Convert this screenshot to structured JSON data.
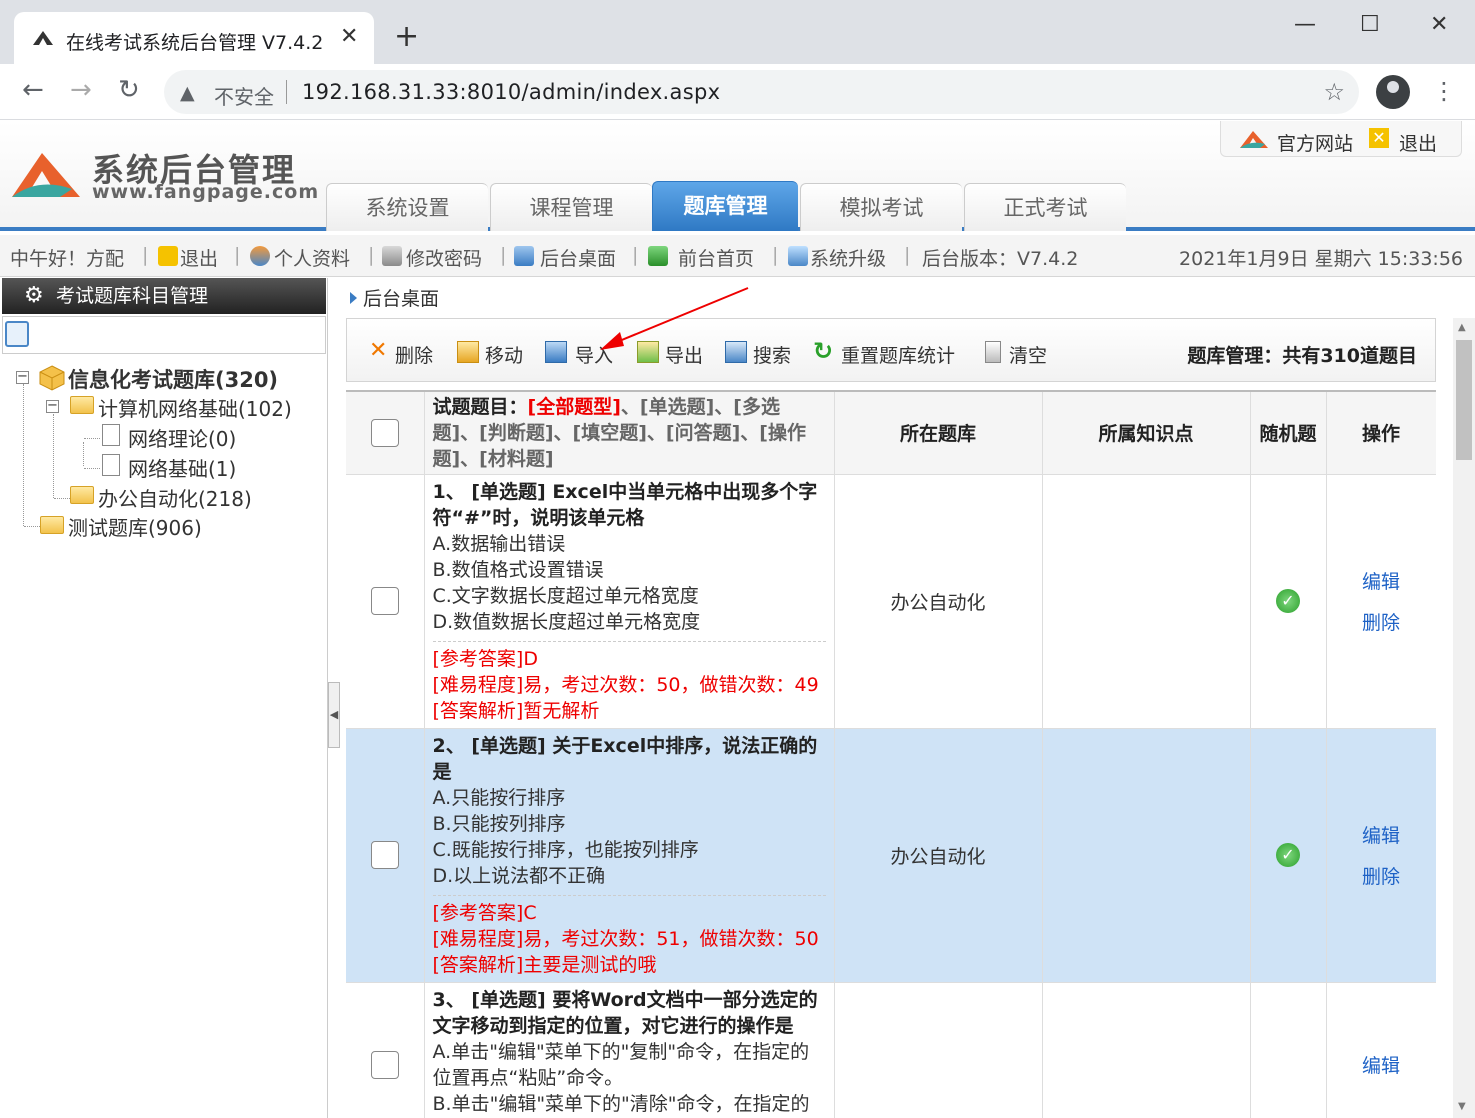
{
  "browser": {
    "tab_title": "在线考试系统后台管理 V7.4.2",
    "tab_close": "✕",
    "new_tab": "+",
    "insecure_label": "不安全",
    "url": "192.168.31.33:8010/admin/index.aspx"
  },
  "header": {
    "logo_title": "系统后台管理",
    "logo_url": "www.fangpage.com",
    "official_site": "官方网站",
    "logout": "退出",
    "nav": [
      "系统设置",
      "课程管理",
      "题库管理",
      "模拟考试",
      "正式考试"
    ],
    "active_nav": "题库管理"
  },
  "infobar": {
    "greeting": "中午好！方配",
    "logout": "退出",
    "profile": "个人资料",
    "password": "修改密码",
    "desktop": "后台桌面",
    "home": "前台首页",
    "upgrade": "系统升级",
    "version": "后台版本：V7.4.2",
    "datetime": "2021年1月9日  星期六 15:33:56"
  },
  "leftpanel": {
    "title": "考试题库科目管理",
    "search_placeholder": "",
    "tree": {
      "root": "信息化考试题库(320)",
      "child1": "计算机网络基础(102)",
      "child1a": "网络理论(0)",
      "child1b": "网络基础(1)",
      "child2": "办公自动化(218)",
      "root2": "测试题库(906)"
    }
  },
  "content": {
    "breadcrumb": "后台桌面",
    "actions": {
      "delete": "删除",
      "move": "移动",
      "import": "导入",
      "export": "导出",
      "search": "搜索",
      "reset": "重置题库统计",
      "clear": "清空"
    },
    "summary": "题库管理：共有310道题目",
    "table": {
      "header_prefix": "试题题目：",
      "header_all": "[全部题型]",
      "header_types": "、[单选题]、[多选题]、[判断题]、[填空题]、[问答题]、[操作题]、[材料题]",
      "col_bank": "所在题库",
      "col_knowledge": "所属知识点",
      "col_random": "随机题",
      "col_op": "操作",
      "edit": "编辑",
      "delete": "删除",
      "rows": [
        {
          "title": "1、 [单选题] Excel中当单元格中出现多个字符“#”时，说明该单元格",
          "options": [
            "A.数据输出错误",
            "B.数值格式设置错误",
            "C.文字数据长度超过单元格宽度",
            "D.数值数据长度超过单元格宽度"
          ],
          "answer": "[参考答案]D",
          "difficulty": "[难易程度]易，考过次数：50，做错次数：49",
          "analysis": "[答案解析]暂无解析",
          "bank": "办公自动化",
          "selected": false
        },
        {
          "title": "2、 [单选题] 关于Excel中排序，说法正确的是",
          "options": [
            "A.只能按行排序",
            "B.只能按列排序",
            "C.既能按行排序，也能按列排序",
            "D.以上说法都不正确"
          ],
          "answer": "[参考答案]C",
          "difficulty": "[难易程度]易，考过次数：51，做错次数：50",
          "analysis": "[答案解析]主要是测试的哦",
          "bank": "办公自动化",
          "selected": true
        },
        {
          "title": "3、 [单选题] 要将Word文档中一部分选定的文字移动到指定的位置，对它进行的操作是",
          "options": [
            "A.单击\"编辑\"菜单下的\"复制\"命令，在指定的位置再点“粘贴”命令。",
            "B.单击\"编辑\"菜单下的\"清除\"命令，在指定的位置再点“复制”命令。"
          ],
          "answer": "",
          "difficulty": "",
          "analysis": "",
          "bank": "",
          "selected": false
        }
      ]
    }
  },
  "colors": {
    "accent": "#2f79c4",
    "selected_row": "#cfe3f6",
    "meta_red": "#e00000",
    "link_blue": "#1e62c6"
  }
}
